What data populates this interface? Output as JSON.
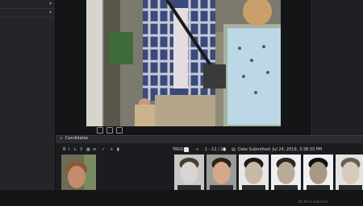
{
  "candidates": {
    "title": "Candidates",
    "probe_tools": [
      "B",
      "I",
      "L",
      "",
      "",
      "",
      "✓",
      "+",
      ""
    ],
    "results": {
      "tags_label": "TAGS",
      "range": "1 - 12 / 29",
      "date": "Date Submitted: Jul 24, 2019, 3:38:33 PM"
    },
    "items": [
      {
        "tone": "#d8d4cf",
        "hair": "#4b3d2e",
        "bg": "#c8c8c8"
      },
      {
        "tone": "#d7a78b",
        "hair": "#2e241b",
        "bg": "#9c9c9c"
      },
      {
        "tone": "#c9b8a6",
        "hair": "#1f1a16",
        "bg": "#e6e6e6"
      },
      {
        "tone": "#b9aa9a",
        "hair": "#2a2622",
        "bg": "#efefef"
      },
      {
        "tone": "#a99886",
        "hair": "#111",
        "bg": "#f1f1f1"
      },
      {
        "tone": "#d8cbbd",
        "hair": "#6b5f52",
        "bg": "#e3e3e3"
      }
    ]
  },
  "status": {
    "text": "No More Searches"
  },
  "colors": {
    "accent": "#2b7de9",
    "panel": "#232528"
  }
}
